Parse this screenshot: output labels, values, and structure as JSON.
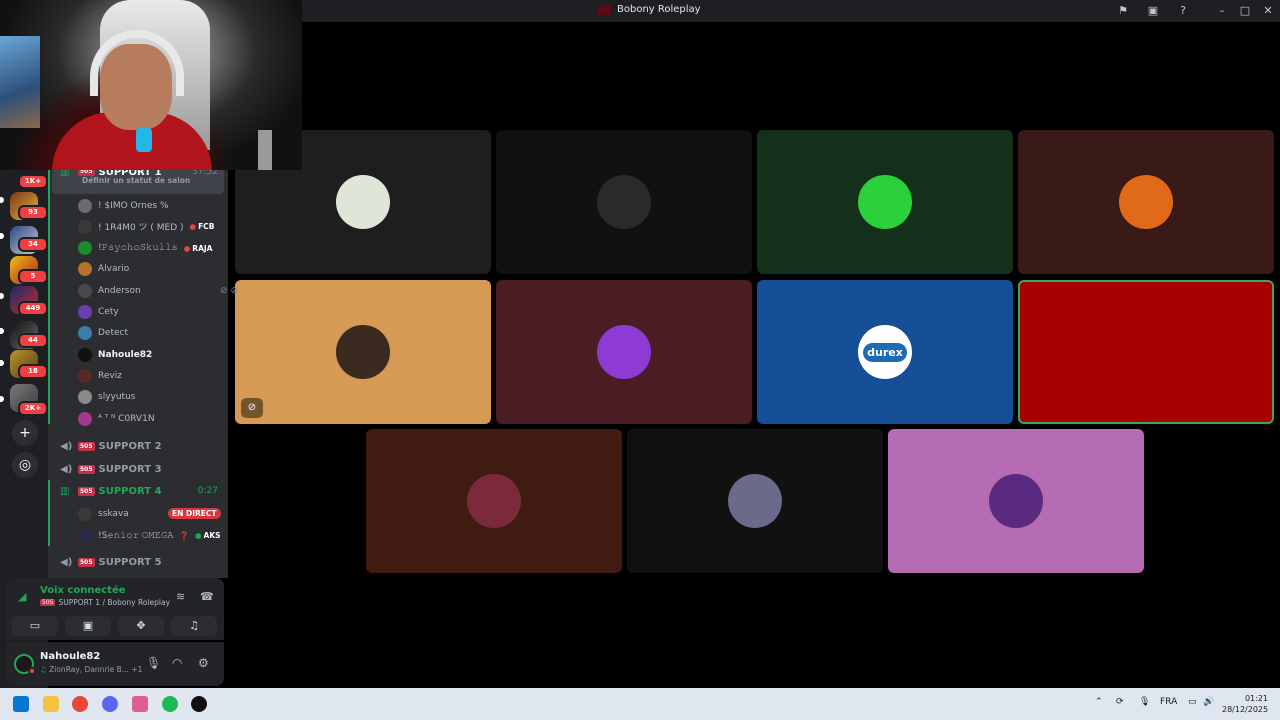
{
  "window": {
    "title": "Bobony Roleplay",
    "controls": [
      "flag-icon",
      "inbox-icon",
      "help-icon",
      "minimize-icon",
      "maximize-icon",
      "close-icon"
    ]
  },
  "server_rail": {
    "badges": [
      "1K+",
      "93",
      "34",
      "5",
      "449",
      "44",
      "18",
      "2K+"
    ],
    "add_server_icon": "plus-icon",
    "discover_icon": "compass-icon"
  },
  "channels": [
    {
      "name": "SUPPORT 1",
      "tag": "505",
      "timer": "37:52",
      "status": "Définir un statut de salon",
      "active": true
    },
    {
      "name": "SUPPORT 2",
      "tag": "505"
    },
    {
      "name": "SUPPORT 3",
      "tag": "505"
    },
    {
      "name": "SUPPORT 4",
      "tag": "505",
      "timer": "0:27"
    },
    {
      "name": "SUPPORT 5",
      "tag": "505"
    }
  ],
  "support1_users": [
    {
      "name": "! $IMO Ornes %",
      "color": "#6b6b6b"
    },
    {
      "name": "! 1R4M0 ツ ( MED )",
      "extra": "FCB",
      "color": "#3a3a3a"
    },
    {
      "name": "!𝙿𝚜𝚢𝚌𝚑𝚘𝚂𝚔𝚞𝚕𝚕𝚜",
      "extra": "RAJA",
      "color": "#1d8a2d"
    },
    {
      "name": "Alvario",
      "color": "#b5722c"
    },
    {
      "name": "Anderson",
      "color": "#4a4a4a"
    },
    {
      "name": "Cety",
      "color": "#6a3fb0"
    },
    {
      "name": "Detect",
      "color": "#3c7ea8"
    },
    {
      "name": "Nahoule82",
      "color": "#111111"
    },
    {
      "name": "Reviz",
      "color": "#5a2a22"
    },
    {
      "name": "slyyutus",
      "color": "#8a8a8a"
    },
    {
      "name": "ᴬ ᵀ ᴺ C0RV1N",
      "color": "#a03a8a"
    }
  ],
  "support4_users": [
    {
      "name": "sskava",
      "badge": "EN DIRECT",
      "color": "#3a3a3a"
    },
    {
      "name": "!S𝚎𝚗𝚒𝚘𝚛 𝙾𝙼𝙴𝙶𝙰",
      "extra": "AKS",
      "color": "#2a2a4a"
    }
  ],
  "voice_panel": {
    "status": "Voix connectée",
    "tag": "505",
    "channel": "SUPPORT 1 / Bobony Roleplay",
    "actions": [
      "camera-off-icon",
      "screen-share-icon",
      "activities-icon",
      "soundboard-icon"
    ]
  },
  "user": {
    "name": "Nahoule82",
    "activity": "ZionRay, Dannrie B...",
    "extra_count": "+1"
  },
  "tiles": [
    {
      "bg": "#1e1e1e",
      "avatar": "#dfe6d8"
    },
    {
      "bg": "#111111",
      "avatar": "#2a2a2a"
    },
    {
      "bg": "#14301a",
      "avatar": "#2bd13a"
    },
    {
      "bg": "#3a1a17",
      "avatar": "#e06a1a"
    },
    {
      "bg": "#d69a55",
      "avatar": "#3a2a20",
      "muted": true
    },
    {
      "bg": "#4a1d25",
      "avatar": "#8e3bd6"
    },
    {
      "bg": "#144e97",
      "avatar": "#ffffff",
      "label": "durex"
    },
    {
      "bg": "#a70000",
      "avatar": "#a70000",
      "speaking": true
    },
    {
      "bg": "#3f1b12",
      "avatar": "#7a2a3a"
    },
    {
      "bg": "#111111",
      "avatar": "#6a6a8a"
    },
    {
      "bg": "#b56cb2",
      "avatar": "#5a2a80"
    }
  ],
  "taskbar": {
    "language": "FRA",
    "time": "01:21",
    "date": "28/12/2025",
    "apps": [
      "windows-icon",
      "file-explorer-icon",
      "chrome-icon",
      "discord-icon",
      "capcut-icon",
      "spotify-icon",
      "rockstar-icon"
    ],
    "colors": {
      "windows": "#0078d4",
      "explorer": "#f5c142",
      "chrome": "#e9463a",
      "discord": "#5865f2",
      "spotify": "#1db954",
      "rockstar": "#111111"
    }
  }
}
